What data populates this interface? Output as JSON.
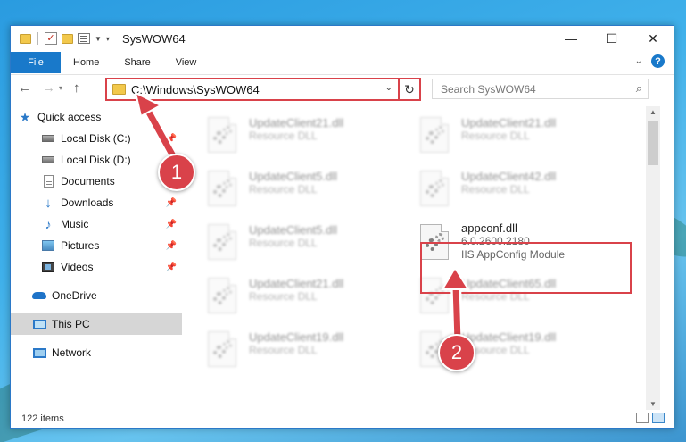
{
  "window": {
    "title": "SysWOW64"
  },
  "ribbon": {
    "file": "File",
    "tabs": [
      "Home",
      "Share",
      "View"
    ],
    "help": "?"
  },
  "address": {
    "path": "C:\\Windows\\SysWOW64"
  },
  "search": {
    "placeholder": "Search SysWOW64"
  },
  "sidebar": {
    "quick_access": "Quick access",
    "items": [
      {
        "label": "Local Disk (C:)",
        "pinned": true
      },
      {
        "label": "Local Disk (D:)",
        "pinned": false
      },
      {
        "label": "Documents",
        "pinned": true
      },
      {
        "label": "Downloads",
        "pinned": true
      },
      {
        "label": "Music",
        "pinned": true
      },
      {
        "label": "Pictures",
        "pinned": true
      },
      {
        "label": "Videos",
        "pinned": true
      }
    ],
    "onedrive": "OneDrive",
    "this_pc": "This PC",
    "network": "Network"
  },
  "files": {
    "col1": [
      {
        "name": "UpdateClient21.dll",
        "type": "Resource DLL"
      },
      {
        "name": "UpdateClient5.dll",
        "type": "Resource DLL"
      },
      {
        "name": "UpdateClient5.dll",
        "type": "Resource DLL"
      },
      {
        "name": "UpdateClient21.dll",
        "type": "Resource DLL"
      },
      {
        "name": "UpdateClient19.dll",
        "type": "Resource DLL"
      }
    ],
    "col2": [
      {
        "name": "UpdateClient21.dll",
        "type": "Resource DLL"
      },
      {
        "name": "UpdateClient42.dll",
        "type": "Resource DLL"
      },
      {
        "name": "UpdateClient65.dll",
        "type": "Resource DLL"
      },
      {
        "name": "UpdateClient19.dll",
        "type": "Resource DLL"
      }
    ],
    "selected": {
      "name": "appconf.dll",
      "version": "6.0.2600.2180",
      "description": "IIS AppConfig Module"
    }
  },
  "status": {
    "items": "122 items"
  },
  "markers": {
    "one": "1",
    "two": "2"
  },
  "colors": {
    "accent": "#1979ca",
    "highlight": "#d9424a"
  }
}
